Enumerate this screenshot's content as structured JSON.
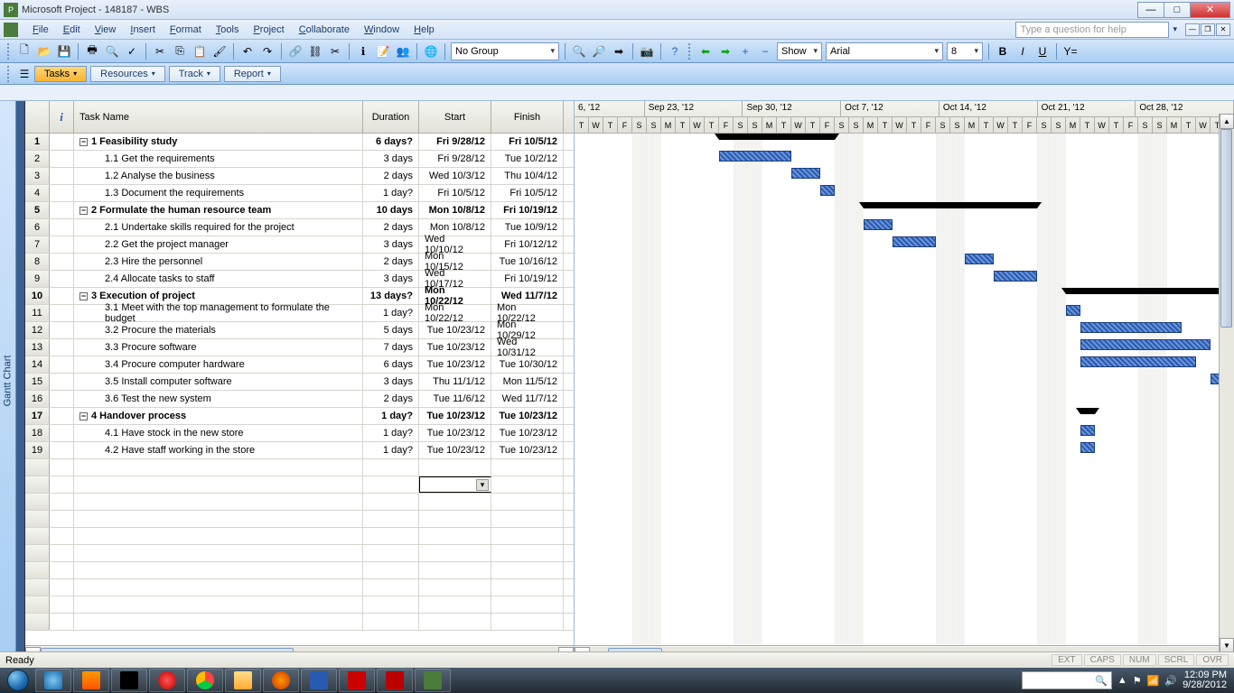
{
  "window": {
    "title": "Microsoft Project - 148187 - WBS",
    "help_placeholder": "Type a question for help"
  },
  "menu": [
    "File",
    "Edit",
    "View",
    "Insert",
    "Format",
    "Tools",
    "Project",
    "Collaborate",
    "Window",
    "Help"
  ],
  "toolbar": {
    "group_select": "No Group",
    "show_label": "Show",
    "font_name": "Arial",
    "font_size": "8"
  },
  "viewbar": {
    "tabs": [
      "Tasks",
      "Resources",
      "Track",
      "Report"
    ]
  },
  "sidebar": {
    "label": "Gantt Chart"
  },
  "columns": {
    "name": "Task Name",
    "duration": "Duration",
    "start": "Start",
    "finish": "Finish"
  },
  "tasks": [
    {
      "id": 1,
      "level": 0,
      "summary": true,
      "name": "1 Feasibility study",
      "duration": "6 days?",
      "start": "Fri 9/28/12",
      "finish": "Fri 10/5/12"
    },
    {
      "id": 2,
      "level": 1,
      "summary": false,
      "name": "1.1 Get the requirements",
      "duration": "3 days",
      "start": "Fri 9/28/12",
      "finish": "Tue 10/2/12"
    },
    {
      "id": 3,
      "level": 1,
      "summary": false,
      "name": "1.2 Analyse the business",
      "duration": "2 days",
      "start": "Wed 10/3/12",
      "finish": "Thu 10/4/12"
    },
    {
      "id": 4,
      "level": 1,
      "summary": false,
      "name": "1.3 Document the requirements",
      "duration": "1 day?",
      "start": "Fri 10/5/12",
      "finish": "Fri 10/5/12"
    },
    {
      "id": 5,
      "level": 0,
      "summary": true,
      "name": "2 Formulate the human resource team",
      "duration": "10 days",
      "start": "Mon 10/8/12",
      "finish": "Fri 10/19/12"
    },
    {
      "id": 6,
      "level": 1,
      "summary": false,
      "name": "2.1 Undertake skills required for the project",
      "duration": "2 days",
      "start": "Mon 10/8/12",
      "finish": "Tue 10/9/12"
    },
    {
      "id": 7,
      "level": 1,
      "summary": false,
      "name": "2.2 Get the project manager",
      "duration": "3 days",
      "start": "Wed 10/10/12",
      "finish": "Fri 10/12/12"
    },
    {
      "id": 8,
      "level": 1,
      "summary": false,
      "name": "2.3 Hire the personnel",
      "duration": "2 days",
      "start": "Mon 10/15/12",
      "finish": "Tue 10/16/12"
    },
    {
      "id": 9,
      "level": 1,
      "summary": false,
      "name": "2.4 Allocate tasks to staff",
      "duration": "3 days",
      "start": "Wed 10/17/12",
      "finish": "Fri 10/19/12"
    },
    {
      "id": 10,
      "level": 0,
      "summary": true,
      "name": "3 Execution of project",
      "duration": "13 days?",
      "start": "Mon 10/22/12",
      "finish": "Wed 11/7/12"
    },
    {
      "id": 11,
      "level": 1,
      "summary": false,
      "name": "3.1 Meet with the top management to formulate the budget",
      "duration": "1 day?",
      "start": "Mon 10/22/12",
      "finish": "Mon 10/22/12"
    },
    {
      "id": 12,
      "level": 1,
      "summary": false,
      "name": "3.2 Procure the materials",
      "duration": "5 days",
      "start": "Tue 10/23/12",
      "finish": "Mon 10/29/12"
    },
    {
      "id": 13,
      "level": 1,
      "summary": false,
      "name": "3.3 Procure software",
      "duration": "7 days",
      "start": "Tue 10/23/12",
      "finish": "Wed 10/31/12"
    },
    {
      "id": 14,
      "level": 1,
      "summary": false,
      "name": "3.4 Procure computer hardware",
      "duration": "6 days",
      "start": "Tue 10/23/12",
      "finish": "Tue 10/30/12"
    },
    {
      "id": 15,
      "level": 1,
      "summary": false,
      "name": "3.5 Install computer software",
      "duration": "3 days",
      "start": "Thu 11/1/12",
      "finish": "Mon 11/5/12"
    },
    {
      "id": 16,
      "level": 1,
      "summary": false,
      "name": "3.6 Test the new system",
      "duration": "2 days",
      "start": "Tue 11/6/12",
      "finish": "Wed 11/7/12"
    },
    {
      "id": 17,
      "level": 0,
      "summary": true,
      "name": "4 Handover process",
      "duration": "1 day?",
      "start": "Tue 10/23/12",
      "finish": "Tue 10/23/12"
    },
    {
      "id": 18,
      "level": 1,
      "summary": false,
      "name": "4.1 Have stock in the new store",
      "duration": "1 day?",
      "start": "Tue 10/23/12",
      "finish": "Tue 10/23/12"
    },
    {
      "id": 19,
      "level": 1,
      "summary": false,
      "name": "4.2 Have staff working in the store",
      "duration": "1 day?",
      "start": "Tue 10/23/12",
      "finish": "Tue 10/23/12"
    }
  ],
  "timescale": {
    "weeks": [
      "6, '12",
      "Sep 23, '12",
      "Sep 30, '12",
      "Oct 7, '12",
      "Oct 14, '12",
      "Oct 21, '12",
      "Oct 28, '12"
    ],
    "day_letters": [
      "S",
      "M",
      "T",
      "W",
      "T",
      "F",
      "S"
    ],
    "first_week_visible_days": [
      "T",
      "W",
      "T",
      "F",
      "S"
    ]
  },
  "statusbar": {
    "left": "Ready",
    "indicators": [
      "EXT",
      "CAPS",
      "NUM",
      "SCRL",
      "OVR"
    ]
  },
  "tray": {
    "time": "12:09 PM",
    "date": "9/28/2012"
  }
}
